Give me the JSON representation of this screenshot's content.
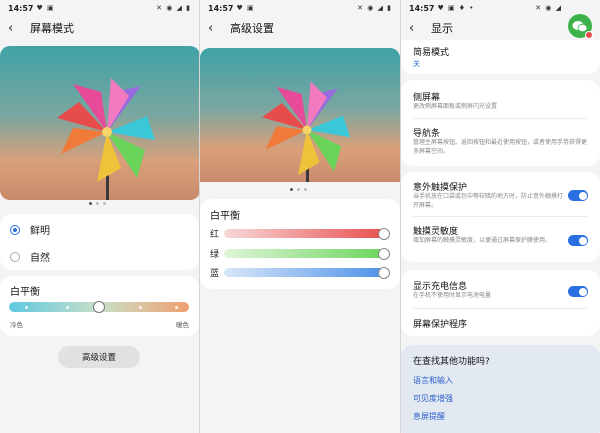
{
  "screens": [
    {
      "status_time": "14:57",
      "title": "屏幕模式",
      "modes": [
        "鲜明",
        "自然"
      ],
      "selected_mode": "鲜明",
      "white_balance": {
        "title": "白平衡",
        "left_label": "冷色",
        "right_label": "暖色",
        "level": 0.5
      },
      "advanced_button": "高级设置"
    },
    {
      "status_time": "14:57",
      "title": "高级设置",
      "white_balance_title": "白平衡",
      "rgb": [
        {
          "label": "红",
          "level": 1.0,
          "color": "#e74c4c"
        },
        {
          "label": "绿",
          "level": 1.0,
          "color": "#6ad45a"
        },
        {
          "label": "蓝",
          "level": 1.0,
          "color": "#4a8fe8"
        }
      ]
    },
    {
      "status_time": "14:57",
      "title": "显示",
      "easy_mode": {
        "title": "简易模式",
        "value": "关"
      },
      "edge_screen": {
        "title": "侧屏幕",
        "sub": "更改侧屏幕面板或侧屏闪光设置"
      },
      "nav_bar": {
        "title": "导航条",
        "sub": "管理主屏幕按钮。返回按钮和最近使用按钮，或者使用手势获得更多屏幕空间。"
      },
      "accidental_touch": {
        "title": "意外触摸保护",
        "sub": "当手机放在口袋或包中等较暗的地方时，防止意外触摸打开屏幕。",
        "on": true
      },
      "touch_sensitivity": {
        "title": "触摸灵敏度",
        "sub": "增加屏幕的触摸灵敏度，以便通过屏幕保护膜使用。",
        "on": true
      },
      "charging_info": {
        "title": "显示充电信息",
        "sub": "在手机不使用时显示电池电量",
        "on": true
      },
      "screensaver": {
        "title": "屏幕保护程序"
      },
      "find_more": {
        "title": "在查找其他功能吗?",
        "links": [
          "语言和输入",
          "可见度增强",
          "息屏提醒"
        ]
      }
    }
  ],
  "colors": {
    "accent": "#2a6fe0",
    "link": "#2a5fcf",
    "toggle_on": "#2a6fe0"
  }
}
